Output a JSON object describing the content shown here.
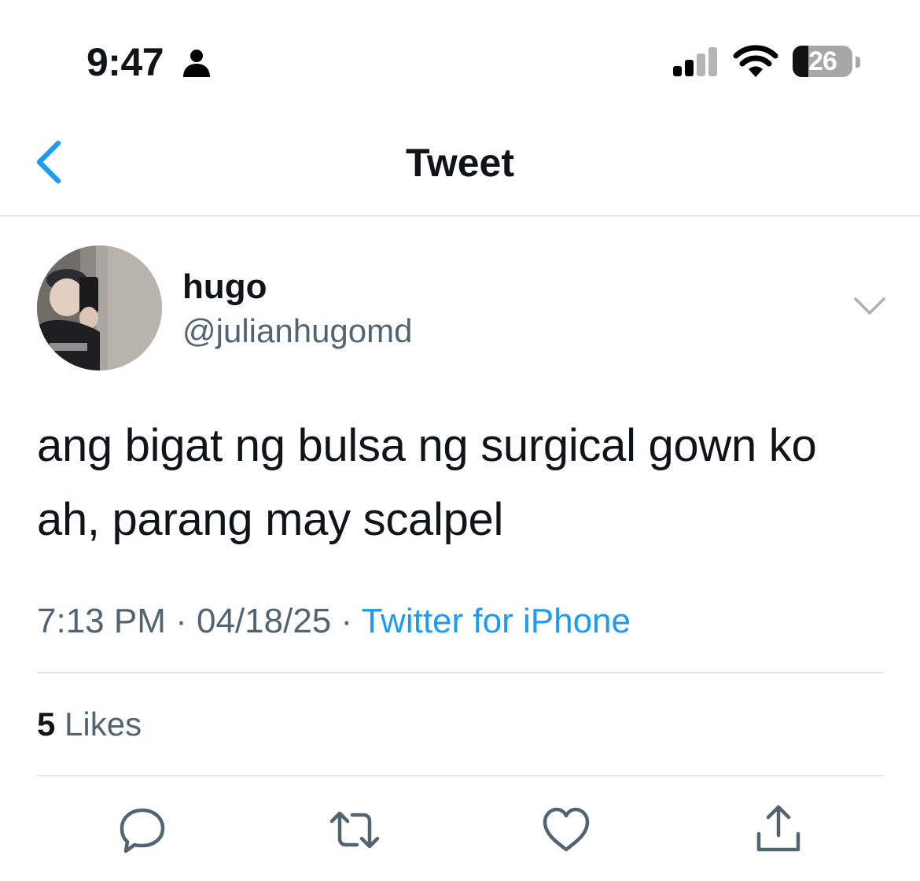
{
  "status_bar": {
    "time": "9:47",
    "battery": "26",
    "battery_level": 0.26,
    "icons": [
      "person-icon",
      "signal-icon",
      "wifi-icon",
      "battery-icon"
    ]
  },
  "nav": {
    "title": "Tweet",
    "back_icon": "chevron-left-icon"
  },
  "tweet": {
    "display_name": "hugo",
    "handle": "@julianhugomd",
    "text": "ang bigat ng bulsa ng surgical gown ko ah, parang may scalpel",
    "time": "7:13 PM",
    "separator": "·",
    "date": "04/18/25",
    "source": "Twitter for iPhone",
    "likes_count": "5",
    "likes_label": "Likes"
  },
  "actions": [
    "reply-icon",
    "retweet-icon",
    "like-icon",
    "share-icon"
  ],
  "colors": {
    "accent": "#1d9bf0",
    "text_primary": "#0f1419",
    "text_secondary": "#536471",
    "divider": "#e1e4e7"
  }
}
